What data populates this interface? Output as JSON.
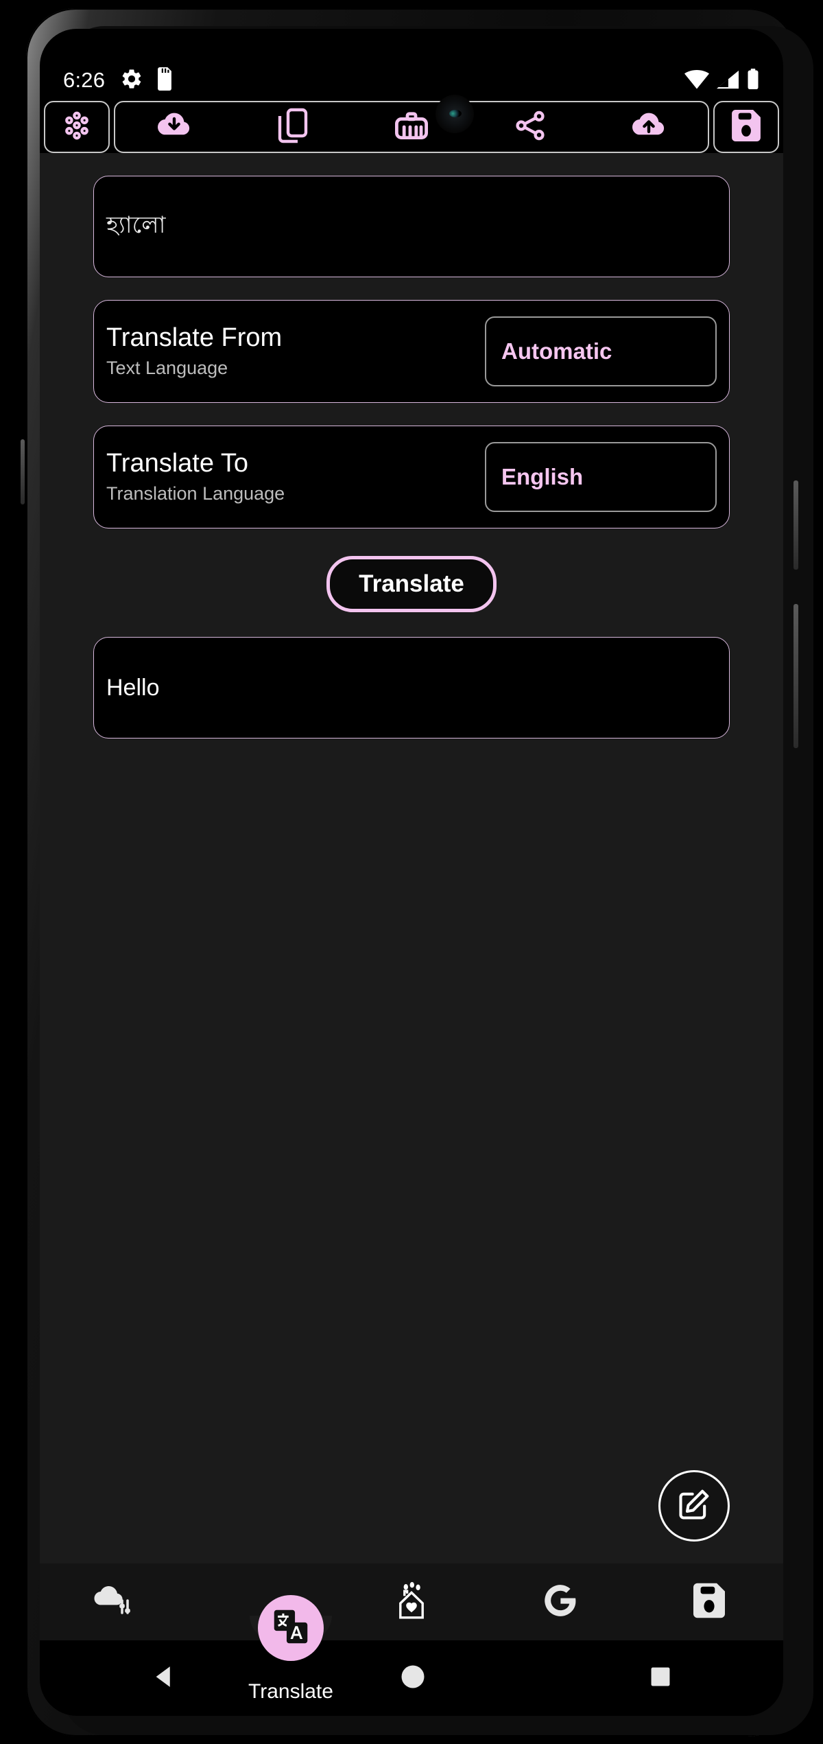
{
  "status_bar": {
    "time": "6:26",
    "left_icons": [
      "settings-gear-icon",
      "sd-card-icon"
    ],
    "right_icons": [
      "wifi-icon",
      "cellular-signal-icon",
      "battery-icon"
    ]
  },
  "app_toolbar": {
    "buttons": [
      {
        "name": "apps-grid-icon",
        "label": ""
      },
      {
        "name": "cloud-download-icon",
        "label": ""
      },
      {
        "name": "copy-device-icon",
        "label": ""
      },
      {
        "name": "keyboard-icon",
        "label": ""
      },
      {
        "name": "share-icon",
        "label": ""
      },
      {
        "name": "cloud-upload-icon",
        "label": ""
      },
      {
        "name": "save-floppy-icon",
        "label": ""
      }
    ]
  },
  "main": {
    "source_text": "হ্যালো",
    "translate_from": {
      "title": "Translate From",
      "subtitle": "Text Language",
      "value": "Automatic"
    },
    "translate_to": {
      "title": "Translate To",
      "subtitle": "Translation Language",
      "value": "English"
    },
    "translate_button": "Translate",
    "result_text": "Hello"
  },
  "fab": {
    "name": "edit-compose-icon"
  },
  "bottom_nav": {
    "items": [
      {
        "name": "cloud-settings-icon",
        "label": ""
      },
      {
        "name": "google-translate-icon",
        "label": "Translate"
      },
      {
        "name": "home-favorite-icon",
        "label": ""
      },
      {
        "name": "google-g-icon",
        "label": ""
      },
      {
        "name": "save-floppy-icon",
        "label": ""
      }
    ]
  },
  "system_nav": {
    "back": "back-triangle-icon",
    "home": "home-circle-icon",
    "recents": "recents-square-icon"
  },
  "colors": {
    "accent_pink": "#f2b9ea",
    "border_pink": "#d8b8dd",
    "screen_bg": "#1b1b1b",
    "field_bg": "#000000",
    "text_primary": "#ffffff",
    "text_secondary": "#bdbdbd"
  }
}
